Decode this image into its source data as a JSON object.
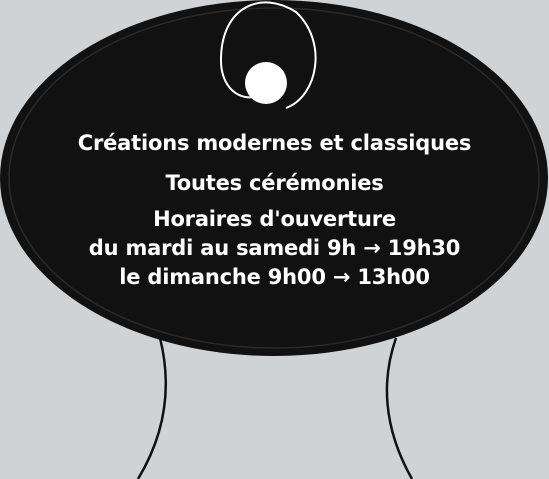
{
  "sign": {
    "line1": "Créations modernes et classiques",
    "line2": "Toutes cérémonies",
    "hours_title": "Horaires d'ouverture",
    "hours_weekday": "du mardi au samedi 9h → 19h30",
    "hours_sunday": "le dimanche 9h00 → 13h00"
  },
  "colors": {
    "background": "#d0d3d6",
    "sign_fill": "#111111",
    "text": "#ffffff"
  }
}
